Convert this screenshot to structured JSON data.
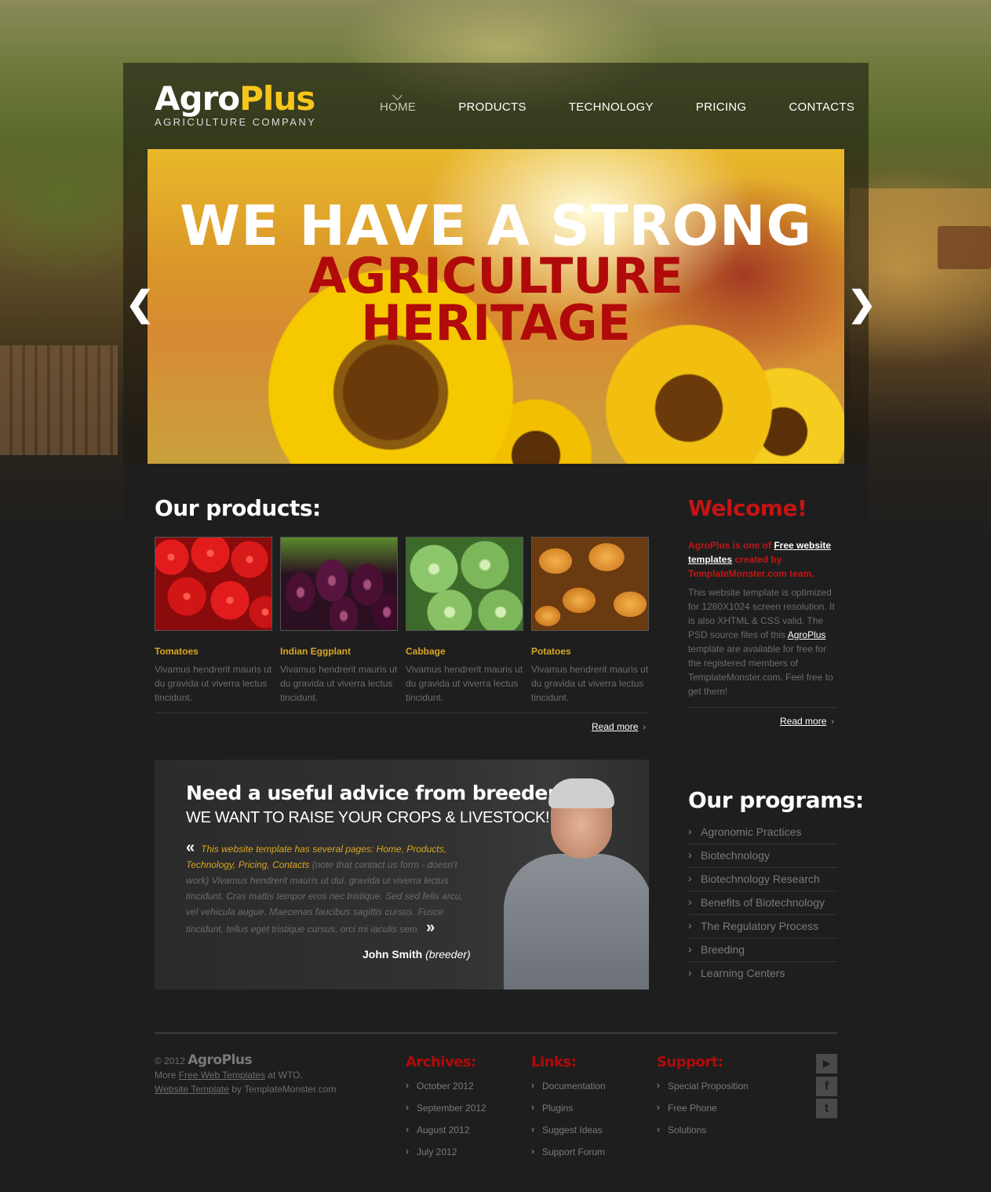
{
  "brand": {
    "name_part1": "Agro",
    "name_part2": "Plus",
    "tagline": "AGRICULTURE COMPANY"
  },
  "nav": {
    "items": [
      {
        "label": "HOME",
        "active": true
      },
      {
        "label": "PRODUCTS",
        "active": false
      },
      {
        "label": "TECHNOLOGY",
        "active": false
      },
      {
        "label": "PRICING",
        "active": false
      },
      {
        "label": "CONTACTS",
        "active": false
      }
    ]
  },
  "slider": {
    "line1": "WE HAVE A STRONG",
    "line2": "AGRICULTURE",
    "line3": "HERITAGE",
    "prev": "❮",
    "next": "❯"
  },
  "products": {
    "title": "Our products:",
    "items": [
      {
        "name": "Tomatoes",
        "desc": "Vivamus hendrerit mauris ut du gravida ut viverra lectus tincidunt."
      },
      {
        "name": "Indian Eggplant",
        "desc": "Vivamus hendrerit mauris ut du gravida ut viverra lectus tincidunt."
      },
      {
        "name": "Cabbage",
        "desc": "Vivamus hendrerit mauris ut du gravida ut viverra lectus tincidunt."
      },
      {
        "name": "Potatoes",
        "desc": "Vivamus hendrerit mauris ut du gravida ut viverra lectus tincidunt."
      }
    ],
    "read_more": "Read more"
  },
  "welcome": {
    "title": "Welcome!",
    "intro_a": "AgroPlus is one of ",
    "intro_link": "Free website templates",
    "intro_b": " created by TemplateMonster.com team.",
    "body_a": "This website template is optimized for 1280X1024 screen resolution. It is also XHTML & CSS valid. The PSD source files of this ",
    "body_link": "AgroPlus",
    "body_b": " template are available for free for the registered members of TemplateMonster.com. Feel free to get them!",
    "read_more": "Read more"
  },
  "advice": {
    "title": "Need a useful advice from breeder?",
    "subtitle": "WE WANT TO RAISE YOUR CROPS & LIVESTOCK!",
    "quote_highlight": "This website template has several pages: Home, Products, Technology, Pricing, Contacts",
    "quote_rest": " (note that contact us form - doesn't work) Vivamus hendrerit mauris ut dui. gravida ut viverra lectus tincidunt. Cras mattis tempor eros nec tristique. Sed sed felis arcu, vel vehicula augue. Maecenas faucibus sagittis cursus. Fusce tincidunt, tellus eget tristique cursus, orci mi iaculis sem.",
    "open_quote": "«",
    "close_quote": "»",
    "author": "John Smith",
    "role": "(breeder)"
  },
  "programs": {
    "title": "Our programs:",
    "items": [
      "Agronomic Practices",
      "Biotechnology",
      "Biotechnology Research",
      "Benefits of Biotechnology",
      "The Regulatory Process",
      "Breeding",
      "Learning Centers"
    ]
  },
  "footer": {
    "copy_prefix": "© 2012",
    "brand": "AgroPlus",
    "line2_a": "More ",
    "line2_link": "Free Web Templates",
    "line2_b": " at WTO.",
    "line3_link": "Website Template",
    "line3_b": " by TemplateMonster.com",
    "archives": {
      "title": "Archives:",
      "items": [
        "October 2012",
        "September 2012",
        "August 2012",
        "July 2012"
      ]
    },
    "links": {
      "title": "Links:",
      "items": [
        "Documentation",
        "Plugins",
        "Suggest Ideas",
        "Support Forum"
      ]
    },
    "support": {
      "title": "Support:",
      "items": [
        "Special Proposition",
        "Free Phone",
        "Solutions"
      ]
    },
    "social": [
      {
        "icon": "youtube-icon",
        "glyph": "▶"
      },
      {
        "icon": "facebook-icon",
        "glyph": "f"
      },
      {
        "icon": "twitter-icon",
        "glyph": "t"
      }
    ]
  }
}
